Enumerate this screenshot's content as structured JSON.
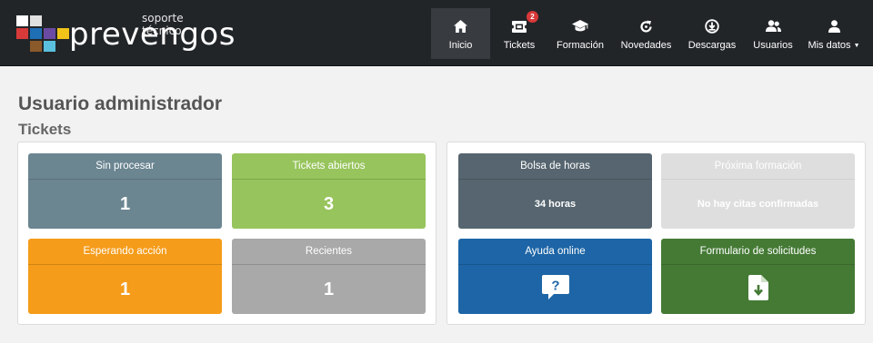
{
  "brand": {
    "name": "prevengos",
    "tagline": "soporte técnico",
    "logo_colors": [
      "#ffffff",
      "#d9d9d9",
      "#cccccc",
      "#d83a3a",
      "#1f6fb5",
      "#6b4aa3",
      "#f0c419",
      "#8a5a2b",
      "#5bc0de"
    ]
  },
  "nav": {
    "items": [
      {
        "label": "Inicio",
        "icon": "home-icon",
        "active": true
      },
      {
        "label": "Tickets",
        "icon": "ticket-icon",
        "badge": "2"
      },
      {
        "label": "Formación",
        "icon": "graduation-cap-icon"
      },
      {
        "label": "Novedades",
        "icon": "refresh-icon"
      },
      {
        "label": "Descargas",
        "icon": "download-circle-icon"
      },
      {
        "label": "Usuarios",
        "icon": "users-icon"
      },
      {
        "label": "Mis datos",
        "icon": "user-icon",
        "caret": true
      }
    ]
  },
  "page": {
    "title": "Usuario administrador",
    "section": "Tickets"
  },
  "tickets": [
    {
      "label": "Sin procesar",
      "value": "1",
      "color": "#6b8591"
    },
    {
      "label": "Tickets abiertos",
      "value": "3",
      "color": "#97c45c"
    },
    {
      "label": "Esperando acción",
      "value": "1",
      "color": "#f59c1a"
    },
    {
      "label": "Recientes",
      "value": "1",
      "color": "#a9a9a9"
    }
  ],
  "info_cards": [
    {
      "label": "Bolsa de horas",
      "text": "34 horas",
      "color": "#56656f"
    },
    {
      "label": "Próxima formación",
      "text": "No hay citas confirmadas",
      "color": "#dedede"
    },
    {
      "label": "Ayuda online",
      "icon": "question-bubble-icon",
      "color": "#1d65a6"
    },
    {
      "label": "Formulario de solicitudes",
      "icon": "file-download-icon",
      "color": "#457a35"
    }
  ]
}
